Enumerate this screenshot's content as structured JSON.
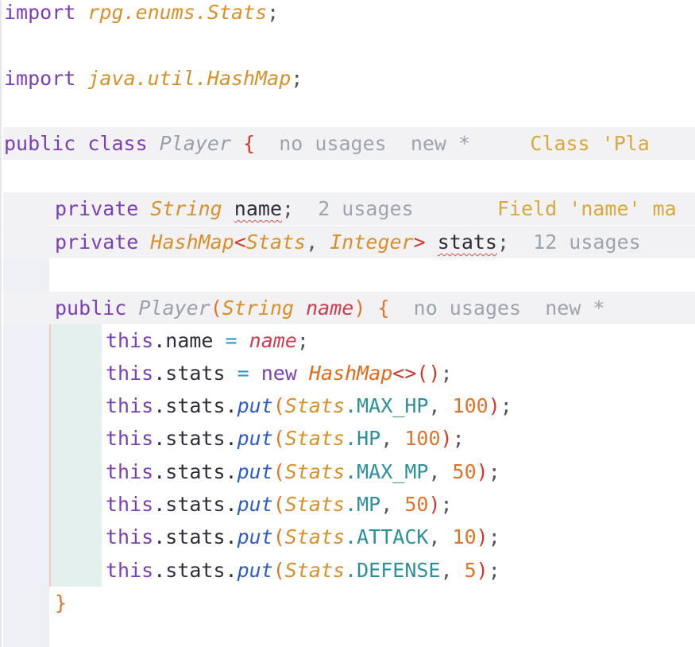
{
  "editor": {
    "lines": {
      "import1": {
        "kw": "import",
        "path": "rpg.enums.Stats",
        "semi": ";"
      },
      "import2": {
        "kw": "import",
        "path": "java.util.HashMap",
        "semi": ";"
      },
      "classDecl": {
        "mods": "public class",
        "name": "Player",
        "brace": "{",
        "usages": "no usages",
        "author": "new *",
        "warning": "Class 'Pla"
      },
      "field1": {
        "mod": "private",
        "type": "String",
        "name": "name",
        "semi": ";",
        "usages": "2 usages",
        "warning": "Field 'name' ma"
      },
      "field2": {
        "mod": "private",
        "type": "HashMap",
        "lt": "<",
        "type_arg1": "Stats",
        "comma": ",",
        "type_arg2": "Integer",
        "gt": ">",
        "name": "stats",
        "semi": ";",
        "usages": "12 usages"
      },
      "ctorDecl": {
        "mod": "public",
        "name": "Player",
        "lparen": "(",
        "param_type": "String",
        "param_name": "name",
        "rparen": ")",
        "brace": "{",
        "usages": "no usages",
        "author": "new *"
      },
      "assign1": {
        "this": "this",
        "field": ".name",
        "op": "=",
        "value": "name",
        "semi": ";"
      },
      "assign2": {
        "this": "this",
        "field": ".stats",
        "op": "=",
        "new": "new",
        "type": "HashMap",
        "diamond": "<>",
        "call": "()",
        "semi": ";"
      },
      "puts": [
        {
          "this": "this",
          "mid": ".stats.",
          "method": "put",
          "lparen": "(",
          "enum": "Stats",
          "const": ".MAX_HP",
          "comma": ",",
          "value": "100",
          "rparen": ")",
          "semi": ";"
        },
        {
          "this": "this",
          "mid": ".stats.",
          "method": "put",
          "lparen": "(",
          "enum": "Stats",
          "const": ".HP",
          "comma": ",",
          "value": "100",
          "rparen": ")",
          "semi": ";"
        },
        {
          "this": "this",
          "mid": ".stats.",
          "method": "put",
          "lparen": "(",
          "enum": "Stats",
          "const": ".MAX_MP",
          "comma": ",",
          "value": "50",
          "rparen": ")",
          "semi": ";"
        },
        {
          "this": "this",
          "mid": ".stats.",
          "method": "put",
          "lparen": "(",
          "enum": "Stats",
          "const": ".MP",
          "comma": ",",
          "value": "50",
          "rparen": ")",
          "semi": ";"
        },
        {
          "this": "this",
          "mid": ".stats.",
          "method": "put",
          "lparen": "(",
          "enum": "Stats",
          "const": ".ATTACK",
          "comma": ",",
          "value": "10",
          "rparen": ")",
          "semi": ";"
        },
        {
          "this": "this",
          "mid": ".stats.",
          "method": "put",
          "lparen": "(",
          "enum": "Stats",
          "const": ".DEFENSE",
          "comma": ",",
          "value": "5",
          "rparen": ")",
          "semi": ";"
        }
      ],
      "closeBrace": {
        "brace": "}"
      }
    }
  }
}
